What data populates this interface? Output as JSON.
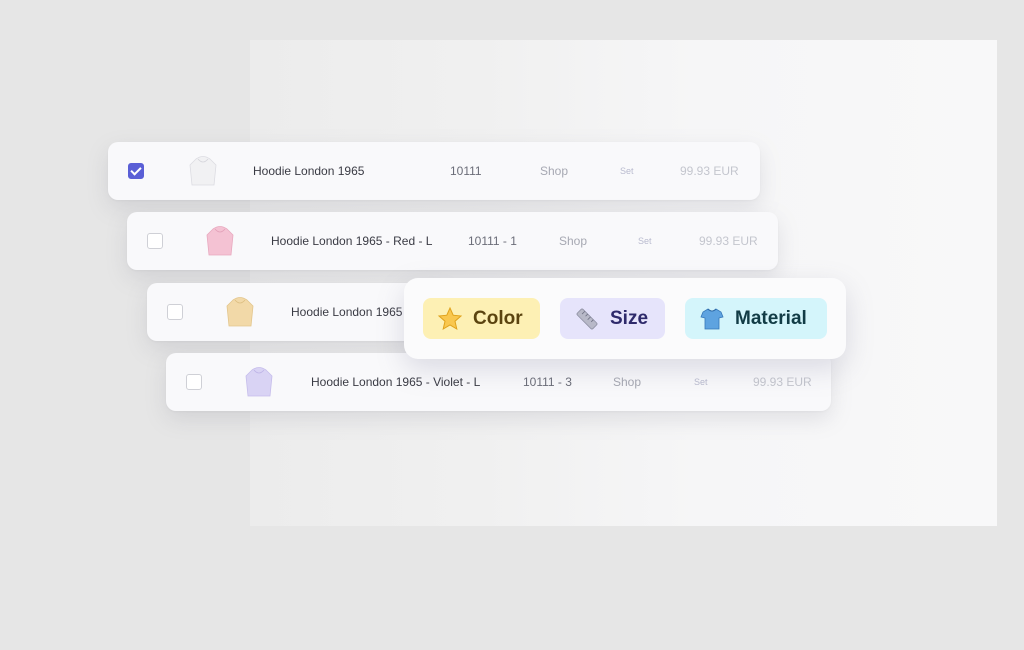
{
  "rows": [
    {
      "name": "Hoodie London 1965",
      "sku": "10111",
      "shop": "Shop",
      "set": "Set",
      "price": "99.93 EUR",
      "checked": true
    },
    {
      "name": "Hoodie London 1965 - Red - L",
      "sku": "10111 - 1",
      "shop": "Shop",
      "set": "Set",
      "price": "99.93 EUR",
      "checked": false
    },
    {
      "name": "Hoodie London 1965",
      "sku": "",
      "shop": "",
      "set": "",
      "price": "",
      "checked": false
    },
    {
      "name": "Hoodie London 1965 - Violet - L",
      "sku": "10111 - 3",
      "shop": "Shop",
      "set": "Set",
      "price": "99.93 EUR",
      "checked": false
    }
  ],
  "chips": [
    {
      "label": "Color",
      "icon": "star-icon",
      "bg": "#fdf0b4",
      "fg": "#5b4410"
    },
    {
      "label": "Size",
      "icon": "ruler-icon",
      "bg": "#e6e4fb",
      "fg": "#2e2a6b"
    },
    {
      "label": "Material",
      "icon": "shirt-icon",
      "bg": "#d4f5fb",
      "fg": "#123c46"
    }
  ],
  "colors": {
    "checkbox_checked": "#5a5fd6",
    "hoodie_white": "#f1f1f3",
    "hoodie_red": "#f4c2d3",
    "hoodie_beige": "#f2d9a8",
    "hoodie_violet": "#d9d3f4"
  }
}
